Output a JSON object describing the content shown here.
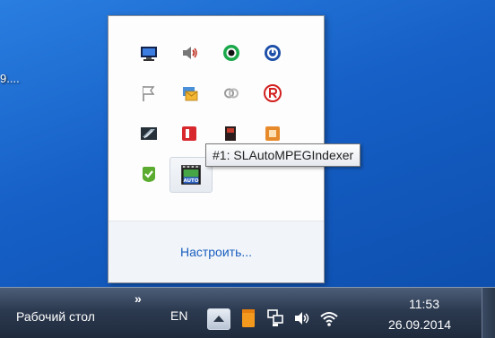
{
  "desktop": {
    "icon_label": "9...."
  },
  "tray_overflow": {
    "icons": [
      {
        "name": "monitor-app-icon"
      },
      {
        "name": "speaker-icon"
      },
      {
        "name": "green-circle-icon"
      },
      {
        "name": "blue-power-icon"
      },
      {
        "name": "action-center-flag-icon"
      },
      {
        "name": "mail-notify-icon"
      },
      {
        "name": "link-rings-icon"
      },
      {
        "name": "red-r-icon"
      },
      {
        "name": "graphics-card-icon"
      },
      {
        "name": "red-app-icon"
      },
      {
        "name": "dark-app-icon"
      },
      {
        "name": "orange-app-icon"
      },
      {
        "name": "green-check-icon"
      },
      {
        "name": "auto-film-icon",
        "label": "AUTO"
      }
    ],
    "customize_label": "Настроить..."
  },
  "tooltip": {
    "text": "#1: SLAutoMPEGIndexer"
  },
  "taskbar": {
    "desktop_toolbar_label": "Рабочий стол",
    "toolbar_chevron": "»",
    "language": "EN",
    "clock_time": "11:53",
    "clock_date": "26.09.2014"
  },
  "colors": {
    "desktop_blue": "#1660c7",
    "link_blue": "#1a5ebd",
    "taskbar_dark": "#2c3a50"
  }
}
